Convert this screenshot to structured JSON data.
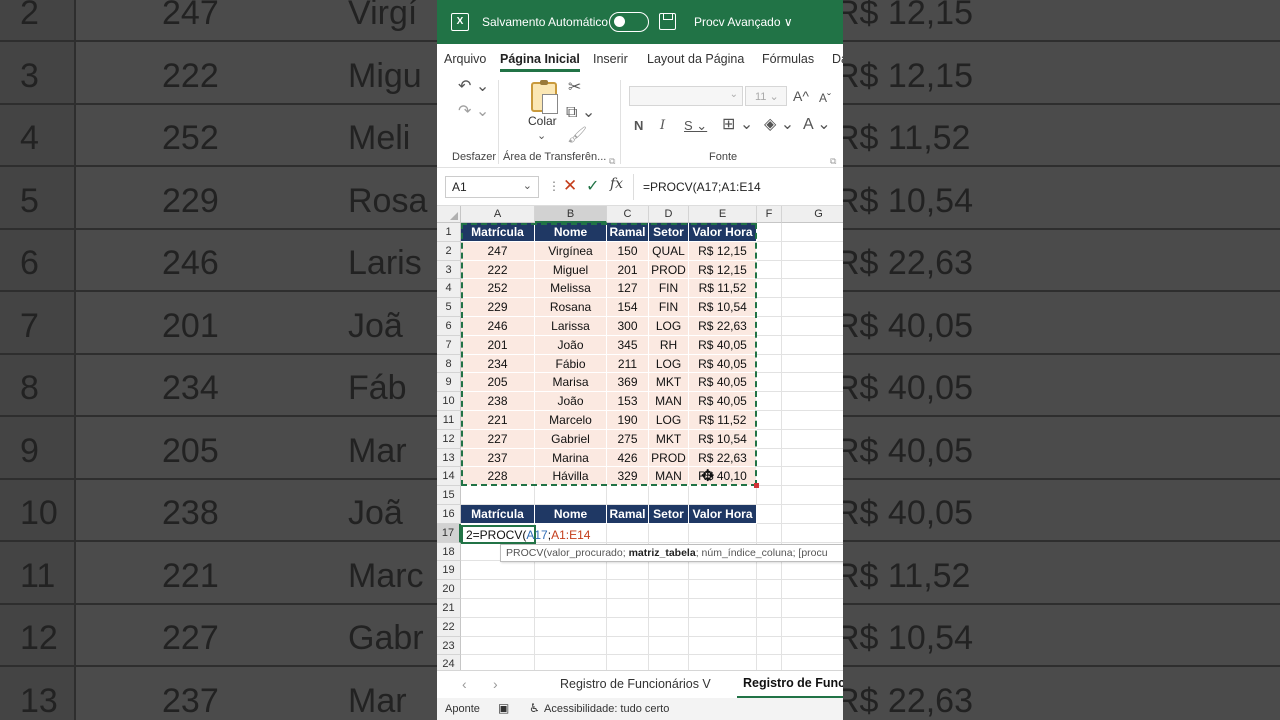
{
  "background_zoom": {
    "rows": [
      {
        "num": "2",
        "mat": "247",
        "name": "Virgí",
        "val": "R$ 12,15"
      },
      {
        "num": "3",
        "mat": "222",
        "name": "Migu",
        "val": "R$ 12,15"
      },
      {
        "num": "4",
        "mat": "252",
        "name": "Meli",
        "val": "R$ 11,52"
      },
      {
        "num": "5",
        "mat": "229",
        "name": "Rosa",
        "val": "R$ 10,54"
      },
      {
        "num": "6",
        "mat": "246",
        "name": "Laris",
        "val": "R$ 22,63"
      },
      {
        "num": "7",
        "mat": "201",
        "name": "Joã",
        "val": "R$ 40,05"
      },
      {
        "num": "8",
        "mat": "234",
        "name": "Fáb",
        "val": "R$ 40,05"
      },
      {
        "num": "9",
        "mat": "205",
        "name": "Mar",
        "val": "R$ 40,05"
      },
      {
        "num": "10",
        "mat": "238",
        "name": "Joã",
        "val": "R$ 40,05"
      },
      {
        "num": "11",
        "mat": "221",
        "name": "Marc",
        "val": "R$ 11,52"
      },
      {
        "num": "12",
        "mat": "227",
        "name": "Gabr",
        "val": "R$ 10,54"
      },
      {
        "num": "13",
        "mat": "237",
        "name": "Mar",
        "val": "R$ 22,63"
      }
    ]
  },
  "titlebar": {
    "autosave_label": "Salvamento Automático",
    "filename": "Procv Avançado ∨",
    "bg_color": "#217346"
  },
  "tabs": [
    "Arquivo",
    "Página Inicial",
    "Inserir",
    "Layout da Página",
    "Fórmulas",
    "Da"
  ],
  "ribbon": {
    "undo_label": "Desfazer",
    "paste_label": "Colar",
    "clipboard_label": "Área de Transferên...",
    "font_label": "Fonte",
    "font_size": "11",
    "icons": [
      "undo-icon",
      "redo-icon",
      "paste-icon",
      "cut-icon",
      "copy-icon",
      "format-painter-icon",
      "increase-font-icon",
      "decrease-font-icon",
      "bold-icon",
      "italic-icon",
      "underline-icon",
      "borders-icon",
      "fill-color-icon",
      "font-color-icon"
    ]
  },
  "formula_bar": {
    "name_box": "A1",
    "formula": "=PROCV(A17;A1:E14"
  },
  "grid": {
    "columns": [
      "A",
      "B",
      "C",
      "D",
      "E",
      "F",
      "G"
    ],
    "row_numbers": [
      "1",
      "2",
      "3",
      "4",
      "5",
      "6",
      "7",
      "8",
      "9",
      "10",
      "11",
      "12",
      "13",
      "14",
      "15",
      "16",
      "17",
      "18",
      "19",
      "20",
      "21",
      "22",
      "23",
      "24"
    ],
    "headers": [
      "Matrícula",
      "Nome",
      "Ramal",
      "Setor",
      "Valor Hora"
    ],
    "rows": [
      [
        "247",
        "Virgínea",
        "150",
        "QUAL",
        "R$ 12,15"
      ],
      [
        "222",
        "Miguel",
        "201",
        "PROD",
        "R$ 12,15"
      ],
      [
        "252",
        "Melissa",
        "127",
        "FIN",
        "R$ 11,52"
      ],
      [
        "229",
        "Rosana",
        "154",
        "FIN",
        "R$ 10,54"
      ],
      [
        "246",
        "Larissa",
        "300",
        "LOG",
        "R$ 22,63"
      ],
      [
        "201",
        "João",
        "345",
        "RH",
        "R$ 40,05"
      ],
      [
        "234",
        "Fábio",
        "211",
        "LOG",
        "R$ 40,05"
      ],
      [
        "205",
        "Marisa",
        "369",
        "MKT",
        "R$ 40,05"
      ],
      [
        "238",
        "João",
        "153",
        "MAN",
        "R$ 40,05"
      ],
      [
        "221",
        "Marcelo",
        "190",
        "LOG",
        "R$ 11,52"
      ],
      [
        "227",
        "Gabriel",
        "275",
        "MKT",
        "R$ 10,54"
      ],
      [
        "237",
        "Marina",
        "426",
        "PROD",
        "R$ 22,63"
      ],
      [
        "228",
        "Hávilla",
        "329",
        "MAN",
        "R$ 40,10"
      ]
    ],
    "lookup_headers": [
      "Matrícula",
      "Nome",
      "Ramal",
      "Setor",
      "Valor Hora"
    ],
    "active_cell": {
      "prefix": "2=PROCV(",
      "ref1": "A17",
      "sep": ";",
      "ref2": "A1:E14"
    },
    "tooltip": {
      "fn": "PROCV(valor_procurado; ",
      "bold": "matriz_tabela",
      "rest": "; núm_índice_coluna; [procu"
    }
  },
  "sheets": {
    "tab1": "Registro de Funcionários V",
    "tab2": "Registro de Func"
  },
  "status": {
    "mode": "Aponte",
    "accessibility": "Acessibilidade: tudo certo"
  }
}
